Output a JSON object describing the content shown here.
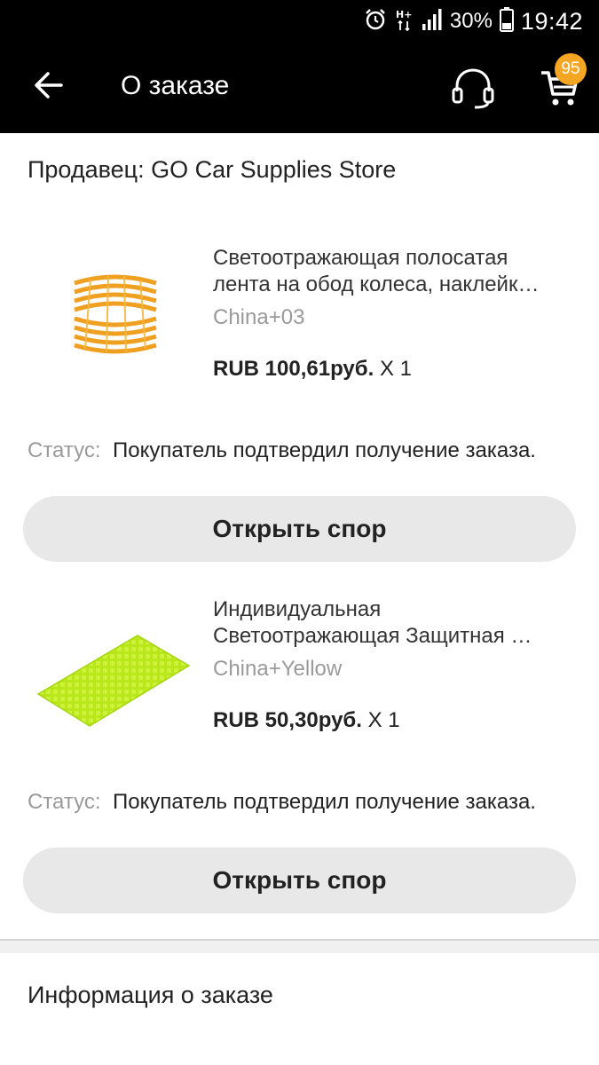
{
  "status_bar": {
    "battery_percent": "30%",
    "time": "19:42",
    "icons": [
      "alarm-icon",
      "h-plus-signal-icon",
      "cell-signal-icon",
      "battery-icon"
    ]
  },
  "app_bar": {
    "title": "О заказе",
    "cart_count": "95",
    "icons": [
      "back-arrow-icon",
      "headset-support-icon",
      "cart-icon"
    ],
    "background": "#000000",
    "badge_color": "#f5a623"
  },
  "seller": {
    "label": "Продавец: GO Car Supplies Store"
  },
  "items": [
    {
      "title_line1": "Светоотражающая полосатая",
      "title_line2": "лента на обод колеса, наклейк…",
      "variant": "China+03",
      "price": "RUB 100,61руб.",
      "qty": "X 1",
      "status_label": "Статус:",
      "status_text": "Покупатель подтвердил получение заказа.",
      "action": "Открыть спор",
      "image_icon": "orange-reflective-stripes-image",
      "accent": "#f0a020"
    },
    {
      "title_line1": "Индивидуальная",
      "title_line2": "Светоотражающая Защитная …",
      "variant": "China+Yellow",
      "price": "RUB 50,30руб.",
      "qty": "X 1",
      "status_label": "Статус:",
      "status_text": "Покупатель подтвердил получение заказа.",
      "action": "Открыть спор",
      "image_icon": "yellow-reflective-sheet-image",
      "accent": "#b8e619"
    }
  ],
  "order_info": {
    "title": "Информация о заказе"
  }
}
